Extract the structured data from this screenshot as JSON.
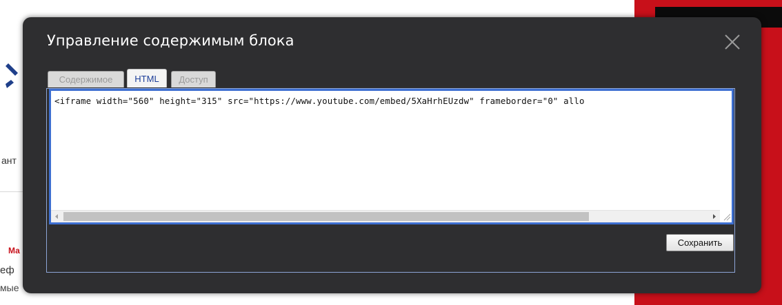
{
  "modal": {
    "title": "Управление содержимым блока",
    "close_icon": "close-icon"
  },
  "tabs": [
    {
      "label": "Содержимое",
      "active": false
    },
    {
      "label": "HTML",
      "active": true
    },
    {
      "label": "Доступ",
      "active": false
    }
  ],
  "editor": {
    "value": "<iframe width=\"560\" height=\"315\" src=\"https://www.youtube.com/embed/5XaHrhEUzdw\" frameborder=\"0\" allo"
  },
  "actions": {
    "save_label": "Сохранить"
  },
  "background": {
    "text1": "ант",
    "text2": "еф",
    "text3": "мые",
    "mark": "Ма"
  },
  "colors": {
    "modal_bg": "#2e2e30",
    "accent_red": "#c8101a",
    "editor_border": "#3d6fd1",
    "html_tab_text": "#1d3e99"
  }
}
